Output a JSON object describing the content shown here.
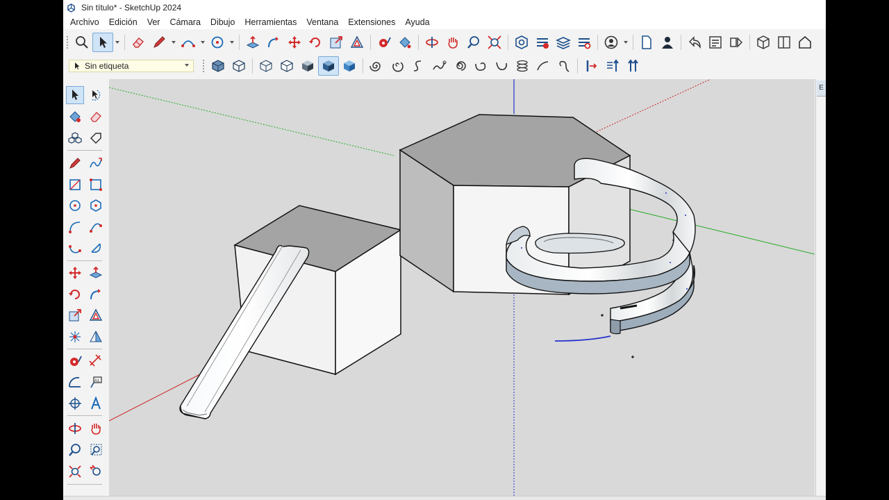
{
  "window": {
    "title": "Sin título* - SketchUp 2024"
  },
  "menu": [
    "Archivo",
    "Edición",
    "Ver",
    "Cámara",
    "Dibujo",
    "Herramientas",
    "Ventana",
    "Extensiones",
    "Ayuda"
  ],
  "tag_selector": {
    "value": "Sin etiqueta"
  },
  "colors": {
    "accent": "#1f6fd1",
    "tool_red": "#d42a2a",
    "tool_blue": "#1b6bb8",
    "viewport_bg": "#d9d9d9",
    "axis_red": "#cc2222",
    "axis_green": "#22aa22",
    "axis_blue": "#2233cc",
    "selection_bg": "#cfe4f7"
  },
  "right_panel": {
    "tab_label": "E"
  }
}
